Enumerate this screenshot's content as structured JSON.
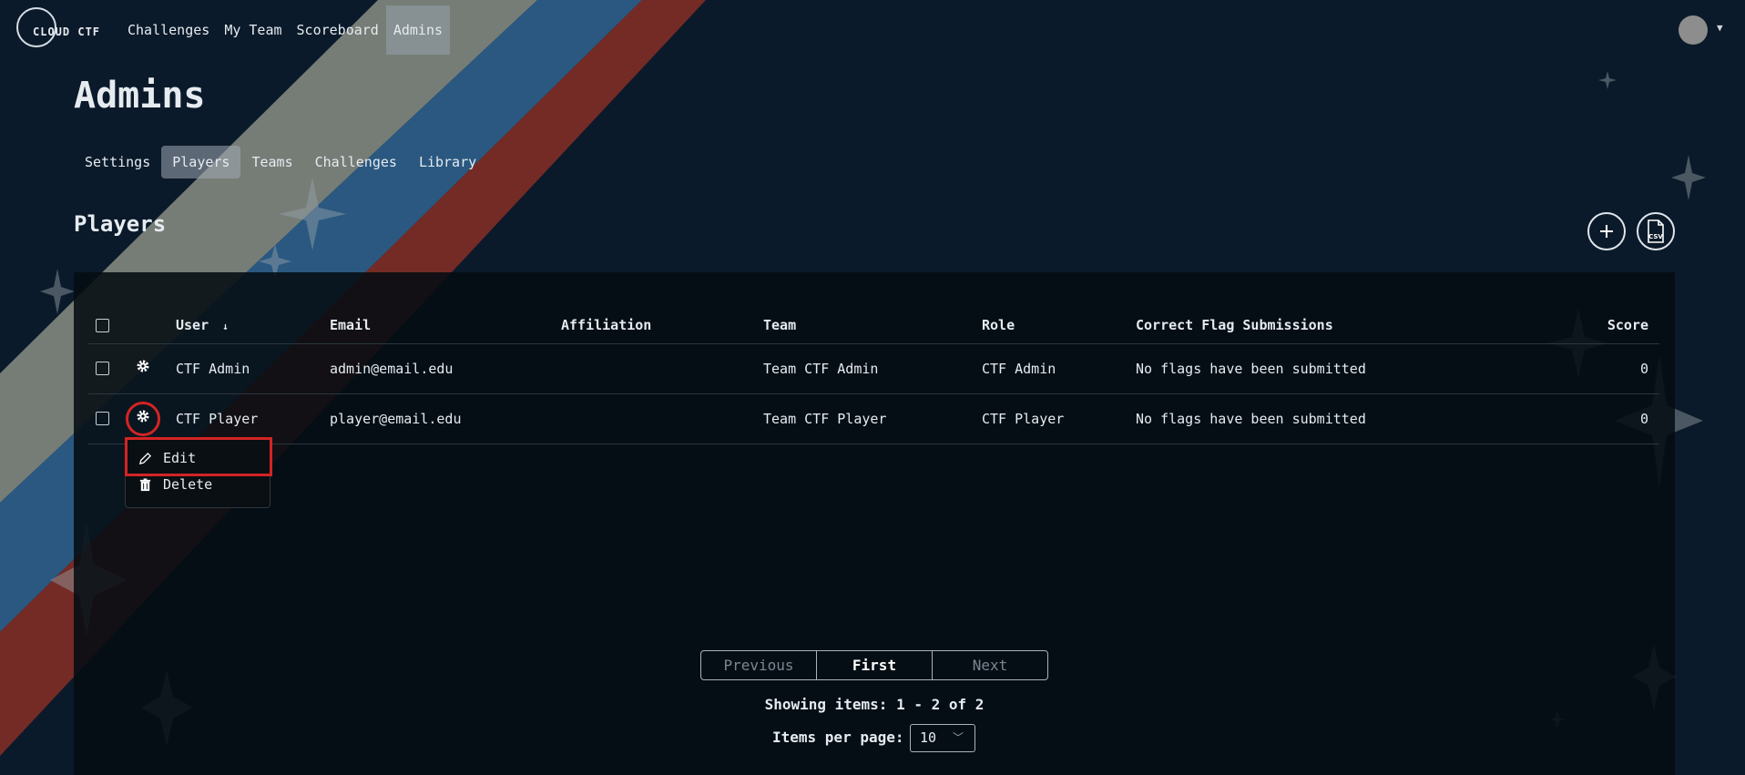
{
  "app": {
    "logo_text": "CLOUD CTF"
  },
  "nav": {
    "links": [
      {
        "label": "Challenges"
      },
      {
        "label": "My Team"
      },
      {
        "label": "Scoreboard"
      },
      {
        "label": "Admins"
      }
    ],
    "active": "Admins"
  },
  "page": {
    "title": "Admins"
  },
  "subnav": {
    "items": [
      {
        "label": "Settings"
      },
      {
        "label": "Players"
      },
      {
        "label": "Teams"
      },
      {
        "label": "Challenges"
      },
      {
        "label": "Library"
      }
    ],
    "active": "Players"
  },
  "section": {
    "title": "Players",
    "add_icon": "plus-icon",
    "csv_icon": "csv-file-icon",
    "csv_label": "CSV"
  },
  "table": {
    "headers": {
      "user": "User",
      "user_sort": "↓",
      "email": "Email",
      "affiliation": "Affiliation",
      "team": "Team",
      "role": "Role",
      "flags": "Correct Flag Submissions",
      "score": "Score"
    },
    "rows": [
      {
        "user": "CTF Admin",
        "email": "admin@email.edu",
        "affiliation": "",
        "team": "Team CTF Admin",
        "role": "CTF Admin",
        "flags": "No flags have been submitted",
        "score": "0"
      },
      {
        "user": "CTF Player",
        "email": "player@email.edu",
        "affiliation": "",
        "team": "Team CTF Player",
        "role": "CTF Player",
        "flags": "No flags have been submitted",
        "score": "0"
      }
    ]
  },
  "row_menu": {
    "edit": "Edit",
    "delete": "Delete"
  },
  "pagination": {
    "previous": "Previous",
    "first": "First",
    "next": "Next",
    "showing": "Showing items: 1 - 2 of 2",
    "per_page_label": "Items per page:",
    "per_page_value": "10"
  },
  "colors": {
    "background": "#0b1a2a",
    "stripe_gray": "#8a8f85",
    "stripe_blue": "#2c5c85",
    "stripe_red": "#7a2c25",
    "highlight": "#d42424"
  }
}
